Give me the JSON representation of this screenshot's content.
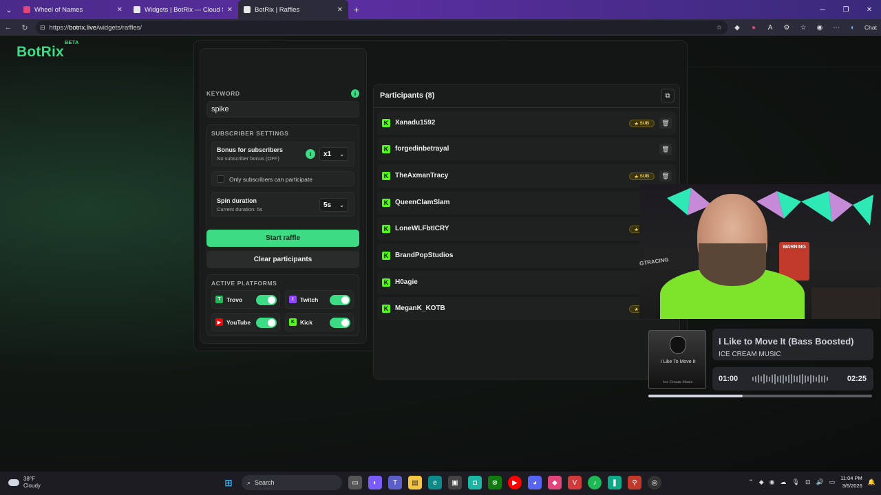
{
  "browser": {
    "tabs": [
      {
        "label": "Wheel of Names",
        "favicon_color": "#e0457b",
        "active": false
      },
      {
        "label": "Widgets | BotRix — Cloud Streaming",
        "favicon_color": "#3ddc84",
        "active": false
      },
      {
        "label": "BotRix | Raffles",
        "favicon_color": "#3ddc84",
        "active": true
      }
    ],
    "url_prefix": "https://",
    "url_host": "botrix.live",
    "url_path": "/widgets/raffles/",
    "chat_label": "Chat"
  },
  "brand": {
    "name": "BotRix",
    "badge": "BETA",
    "accent": "#3ddc84"
  },
  "keyword": {
    "label": "KEYWORD",
    "value": "spike",
    "info": "i"
  },
  "subscriber_settings": {
    "title": "SUBSCRIBER SETTINGS",
    "bonus_title": "Bonus for subscribers",
    "bonus_sub": "No subscriber bonus (OFF)",
    "bonus_value": "x1",
    "only_subs_label": "Only subscribers can participate",
    "spin_title": "Spin duration",
    "spin_sub": "Current duration: 5s",
    "spin_value": "5s"
  },
  "actions": {
    "start": "Start raffle",
    "clear": "Clear participants"
  },
  "platforms": {
    "title": "ACTIVE PLATFORMS",
    "items": [
      {
        "name": "Trovo",
        "enabled": true
      },
      {
        "name": "Twitch",
        "enabled": true
      },
      {
        "name": "YouTube",
        "enabled": true
      },
      {
        "name": "Kick",
        "enabled": true
      }
    ]
  },
  "participants": {
    "header": "Participants (8)",
    "sub_badge": "SUB",
    "list": [
      {
        "name": "Xanadu1592",
        "sub": true
      },
      {
        "name": "forgedinbetrayal",
        "sub": false
      },
      {
        "name": "TheAxmanTracy",
        "sub": true
      },
      {
        "name": "QueenClamSlam",
        "sub": false
      },
      {
        "name": "LoneWLFbtICRY",
        "sub": true
      },
      {
        "name": "BrandPopStudios",
        "sub": false
      },
      {
        "name": "H0agie",
        "sub": false
      },
      {
        "name": "MeganK_KOTB",
        "sub": true
      }
    ]
  },
  "webcam": {
    "sign": "WARNING",
    "wall_text": "GTRACING"
  },
  "now_playing": {
    "title": "I Like to Move It (Bass Boosted)",
    "artist": "ICE CREAM MUSIC",
    "current": "01:00",
    "duration": "02:25",
    "progress": 0.42,
    "art_title": "I Like To Move It",
    "art_sub": "Ice Cream Music"
  },
  "taskbar": {
    "temp": "38°F",
    "condition": "Cloudy",
    "search": "Search",
    "time": "11:04 PM",
    "date": "3/6/2026"
  }
}
